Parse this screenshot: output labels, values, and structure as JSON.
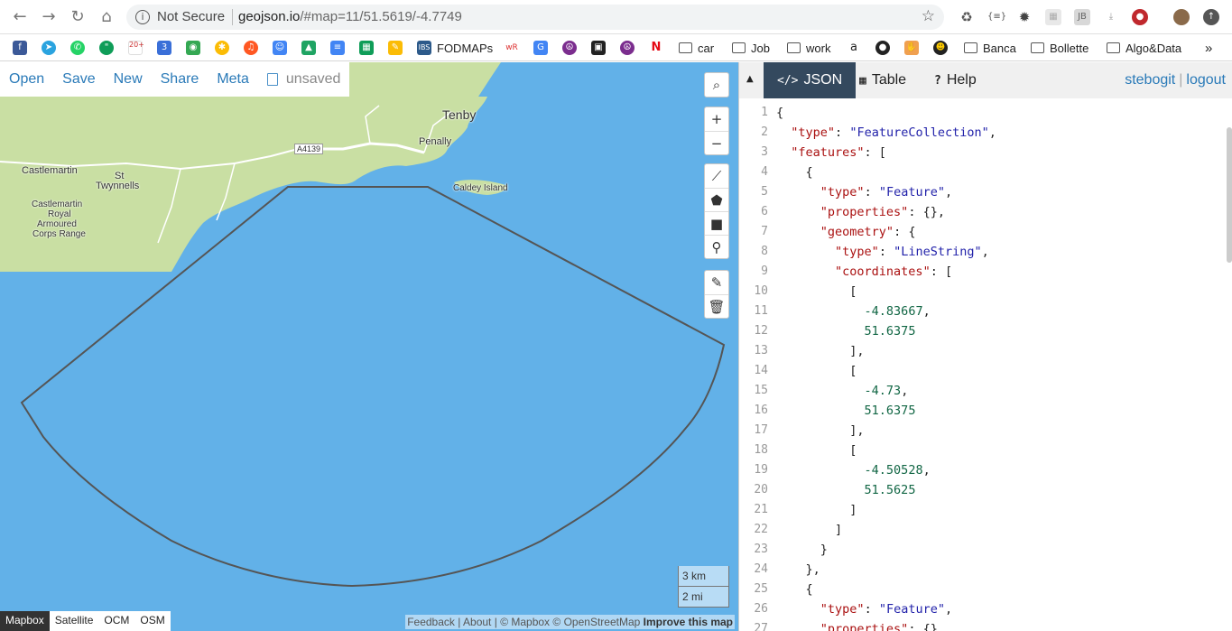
{
  "browser": {
    "security_label": "Not Secure",
    "url_host": "geojson.io",
    "url_rest": "/#map=11/51.5619/-4.7749"
  },
  "bookmarks": {
    "fodmaps": "FODMAPs",
    "car": "car",
    "job": "Job",
    "work": "work",
    "banca": "Banca",
    "bollette": "Bollette",
    "algo": "Algo&Data",
    "more": "»",
    "gmail_count": "20+",
    "calendar_day": "3"
  },
  "map_menu": {
    "open": "Open",
    "save": "Save",
    "new": "New",
    "share": "Share",
    "meta": "Meta",
    "status": "unsaved"
  },
  "map_labels": {
    "tenby": "Tenby",
    "penally": "Penally",
    "road": "A4139",
    "castlemartin": "Castlemartin",
    "st": "St",
    "twynnells": "Twynnells",
    "range1": "Castlemartin",
    "range2": "Royal",
    "range3": "Armoured",
    "range4": "Corps Range",
    "caldey": "Caldey Island"
  },
  "scale": {
    "km": "3 km",
    "mi": "2 mi"
  },
  "layers": [
    "Mapbox",
    "Satellite",
    "OCM",
    "OSM"
  ],
  "attribution": {
    "feedback": "Feedback",
    "about": "About",
    "mapbox": "© Mapbox",
    "osm": "© OpenStreetMap",
    "improve": "Improve this map"
  },
  "pane": {
    "tabs": [
      "JSON",
      "Table",
      "Help"
    ],
    "user": "stebogit",
    "logout": "logout"
  },
  "code_lines": [
    "{",
    "  \"type\": \"FeatureCollection\",",
    "  \"features\": [",
    "    {",
    "      \"type\": \"Feature\",",
    "      \"properties\": {},",
    "      \"geometry\": {",
    "        \"type\": \"LineString\",",
    "        \"coordinates\": [",
    "          [",
    "            -4.83667,",
    "            51.6375",
    "          ],",
    "          [",
    "            -4.73,",
    "            51.6375",
    "          ],",
    "          [",
    "            -4.50528,",
    "            51.5625",
    "          ]",
    "        ]",
    "      }",
    "    },",
    "    {",
    "      \"type\": \"Feature\",",
    "      \"properties\": {},"
  ],
  "colors": {
    "sea": "#62b1e8",
    "land": "#c9dfa3",
    "active_tab": "#34495e",
    "link": "#2a7ab8"
  }
}
